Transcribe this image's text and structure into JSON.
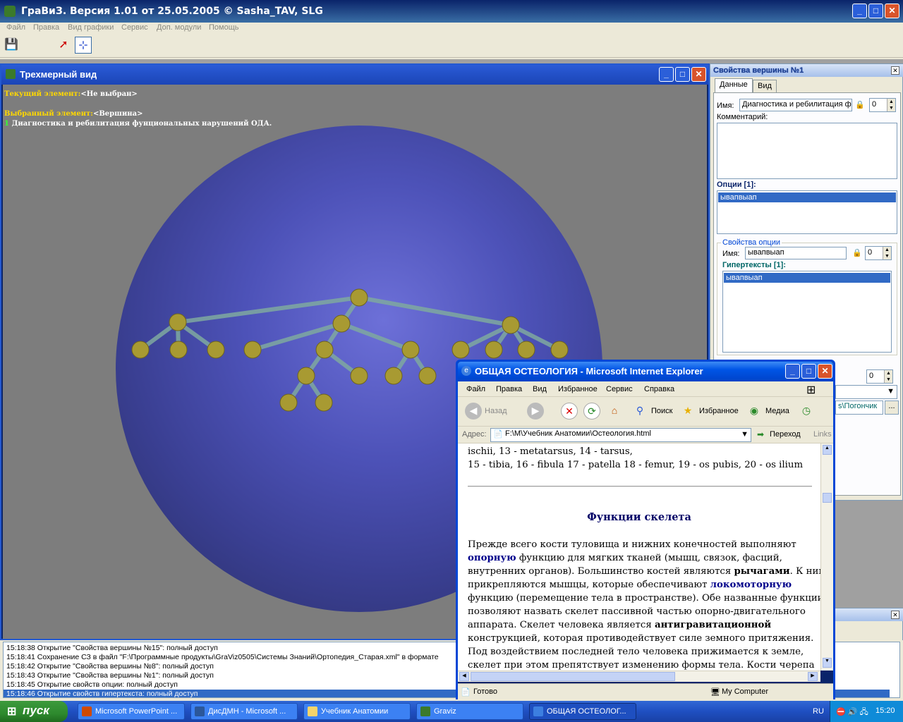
{
  "app": {
    "title": "ГраВиЗ. Версия 1.01 от 25.05.2005     © Sasha_TAV, SLG",
    "menu": [
      "Файл",
      "Правка",
      "Вид графики",
      "Сервис",
      "Доп. модули",
      "Помощь"
    ]
  },
  "view3d": {
    "title": "Трехмерный вид",
    "current_label": "Текущий элемент:",
    "current_value": "<Не выбран>",
    "selected_label": "Выбранный элемент:",
    "selected_value": "<Вершина>",
    "selected_index": "1",
    "selected_name": "Диагностика и ребилитация фунциональных нарушений ОДА."
  },
  "props": {
    "title": "Свойства вершины №1",
    "tabs": [
      "Данные",
      "Вид"
    ],
    "name_label": "Имя:",
    "name_value": "Диагностика и ребилитация ф",
    "name_spin": "0",
    "comment_label": "Комментарий:",
    "options_label": "Опции [1]:",
    "options": [
      "ывапвыап"
    ],
    "option_props_label": "Свойства опции",
    "option_name_label": "Имя:",
    "option_name_value": "ывапвыап",
    "option_spin": "0",
    "hypertexts_label": "Гипертексты [1]:",
    "hypertexts": [
      "ывапвыап"
    ],
    "extra_spin": "0",
    "extra_path": "s\\Погончик",
    "extra_btn": "..."
  },
  "log": {
    "lines": [
      "15:18:38 Открытие \"Свойства вершины №15\": полный доступ",
      "15:18:41 Сохранение СЗ в файл \"F:\\Программные продукты\\GraViz0505\\Системы Знаний\\Ортопедия_Старая.xml\" в формате",
      "15:18:42 Открытие \"Свойства вершины №8\": полный доступ",
      "15:18:43 Открытие \"Свойства вершины №1\": полный доступ",
      "15:18:45 Открытие свойств опции: полный доступ",
      "15:18:46 Открытие свойств гипертекста: полный доступ"
    ]
  },
  "ie": {
    "title": "ОБЩАЯ ОСТЕОЛОГИЯ - Microsoft Internet Explorer",
    "menu": [
      "Файл",
      "Правка",
      "Вид",
      "Избранное",
      "Сервис",
      "Справка"
    ],
    "back": "Назад",
    "search": "Поиск",
    "favorites": "Избранное",
    "media": "Медиа",
    "address_label": "Адрес:",
    "address": "F:\\M\\Учебник Анатомии\\Остеология.html",
    "go": "Переход",
    "links": "Links",
    "status": "Готово",
    "zone": "My Computer",
    "content": {
      "line1": "ischii, 13 - metatarsus, 14 - tarsus,",
      "line2": "15 - tibia, 16 - fibula 17 - patella 18 - femur, 19 - os pubis, 20 - os ilium",
      "heading": "Функции скелета",
      "p1": "Прежде всего кости туловища и нижних конечностей выполняют",
      "kw1": "опорную",
      "p2": " функцию для мягких тканей (мышц, связок, фасций,",
      "p3": "внутренних органов). Большинство костей являются ",
      "kw2": "рычагами",
      "p4": ". К ним",
      "p5": "прикрепляются мышцы, которые обеспечивают ",
      "kw3": "локомоторную",
      "p6": "функцию (перемещение тела в пространстве). Обе названные функции",
      "p7": "позволяют назвать скелет пассивной частью опорно-двигательного",
      "p8": "аппарата. Скелет человека является ",
      "kw4": "антигравитационной",
      "p9": "конструкцией, которая противодействует силе земного притяжения.",
      "p10": "Под воздействием последней тело человека прижимается к земле,",
      "p11": "скелет при этом препятствует изменению формы тела. Кости черепа"
    }
  },
  "taskbar": {
    "start": "пуск",
    "tasks": [
      "Microsoft PowerPoint ...",
      "ДисДМН - Microsoft ...",
      "Учебник Анатомии",
      "Graviz",
      "ОБЩАЯ ОСТЕОЛОГ..."
    ],
    "lang": "RU",
    "clock": "15:20"
  }
}
